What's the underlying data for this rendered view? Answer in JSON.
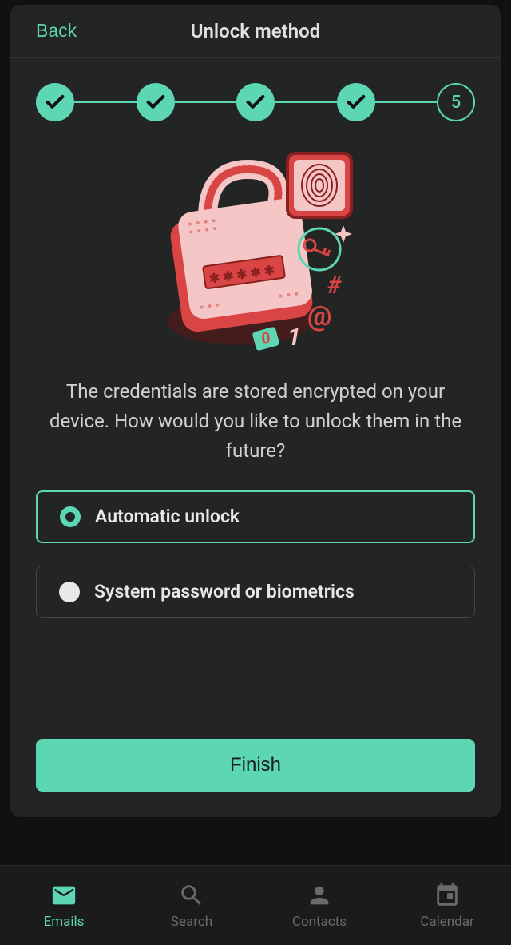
{
  "header": {
    "back_label": "Back",
    "title": "Unlock method"
  },
  "stepper": {
    "total": 5,
    "current_label": "5"
  },
  "description": "The credentials are stored encrypted on your device. How would you like to unlock them in the future?",
  "options": [
    {
      "label": "Automatic unlock",
      "selected": true
    },
    {
      "label": "System password or biometrics",
      "selected": false
    }
  ],
  "action": {
    "finish_label": "Finish"
  },
  "nav": {
    "items": [
      {
        "label": "Emails",
        "icon": "email-icon",
        "active": true
      },
      {
        "label": "Search",
        "icon": "search-icon",
        "active": false
      },
      {
        "label": "Contacts",
        "icon": "contacts-icon",
        "active": false
      },
      {
        "label": "Calendar",
        "icon": "calendar-icon",
        "active": false
      }
    ]
  },
  "colors": {
    "accent": "#5cd6b3",
    "bg": "#111111",
    "modal_bg": "#232424"
  }
}
